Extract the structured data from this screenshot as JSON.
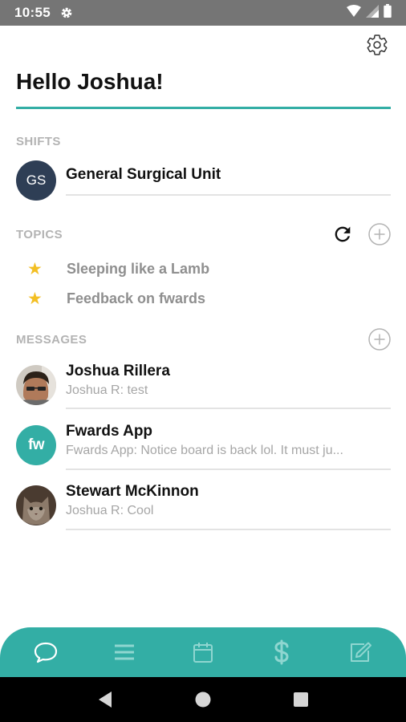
{
  "status_bar": {
    "time": "10:55",
    "icons": [
      "settings-icon",
      "wifi-icon",
      "signal-icon",
      "battery-icon"
    ]
  },
  "header": {
    "greeting": "Hello Joshua!",
    "settings_icon": "gear-icon",
    "accent_color": "#33aea5"
  },
  "shifts": {
    "label": "SHIFTS",
    "items": [
      {
        "initials": "GS",
        "name": "General Surgical Unit",
        "avatar_color": "#2e3e55"
      }
    ]
  },
  "topics": {
    "label": "TOPICS",
    "actions": [
      "refresh-icon",
      "add-icon"
    ],
    "items": [
      {
        "label": "Sleeping like a Lamb",
        "icon": "star-icon",
        "icon_color": "#f3bf24"
      },
      {
        "label": "Feedback on fwards",
        "icon": "star-icon",
        "icon_color": "#f3bf24"
      }
    ]
  },
  "messages": {
    "label": "MESSAGES",
    "actions": [
      "add-icon"
    ],
    "items": [
      {
        "name": "Joshua Rillera",
        "preview": "Joshua R: test",
        "avatar": "photo"
      },
      {
        "name": "Fwards App",
        "preview": "Fwards App: Notice board is back lol. It must ju...",
        "avatar_text": "fw",
        "avatar_color": "#33aea5"
      },
      {
        "name": "Stewart McKinnon",
        "preview": "Joshua R: Cool",
        "avatar": "photo"
      }
    ]
  },
  "tab_bar": {
    "color": "#33aea5",
    "tabs": [
      {
        "icon": "chat-bubble-icon",
        "active": true
      },
      {
        "icon": "menu-icon",
        "active": false
      },
      {
        "icon": "calendar-icon",
        "active": false
      },
      {
        "icon": "dollar-icon",
        "active": false
      },
      {
        "icon": "edit-icon",
        "active": false
      }
    ]
  },
  "nav_bar": {
    "buttons": [
      "back-icon",
      "home-icon",
      "recents-icon"
    ]
  }
}
